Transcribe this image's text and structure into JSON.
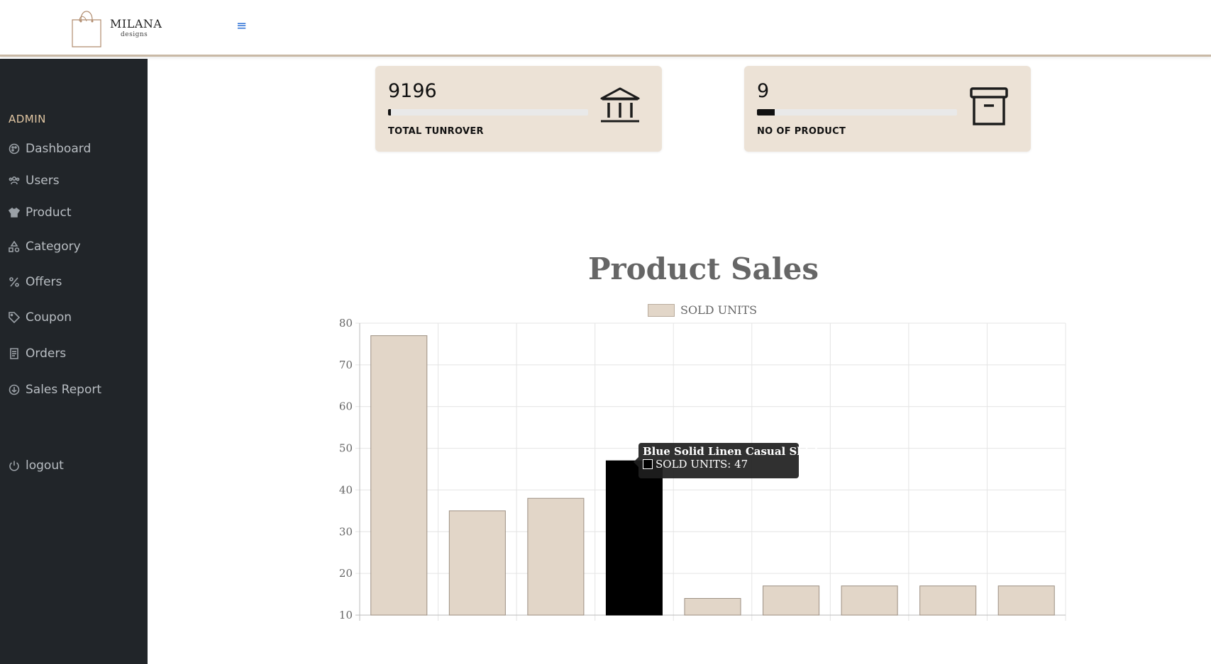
{
  "header": {
    "logo_name": "MILANA",
    "logo_sub": "designs",
    "menu_icon": "hamburger-icon"
  },
  "sidebar": {
    "heading": "ADMIN",
    "items": [
      {
        "label": "Dashboard",
        "icon": "palette-icon"
      },
      {
        "label": "Users",
        "icon": "users-icon"
      },
      {
        "label": "Product",
        "icon": "shirt-icon"
      },
      {
        "label": "Category",
        "icon": "shapes-icon"
      },
      {
        "label": "Offers",
        "icon": "percent-icon"
      },
      {
        "label": "Coupon",
        "icon": "tag-icon"
      },
      {
        "label": "Orders",
        "icon": "receipt-icon"
      },
      {
        "label": "Sales Report",
        "icon": "download-circle-icon"
      },
      {
        "label": "logout",
        "icon": "power-icon"
      }
    ]
  },
  "cards": {
    "turnover": {
      "value": "9196",
      "label": "TOTAL TUNROVER",
      "progress": 0.015,
      "icon": "bank-icon"
    },
    "products": {
      "value": "9",
      "label": "NO OF PRODUCT",
      "progress": 0.09,
      "icon": "archive-icon"
    }
  },
  "chart_data": {
    "type": "bar",
    "title": "Product Sales",
    "series": [
      {
        "name": "SOLD UNITS",
        "values": [
          77,
          35,
          38,
          47,
          14,
          17,
          17,
          17,
          17
        ]
      }
    ],
    "ylim": [
      10,
      80
    ],
    "yticks": [
      10,
      20,
      30,
      40,
      50,
      60,
      70,
      80
    ],
    "bar_color": "#e2d6c8",
    "bar_border": "#9c8f82",
    "highlight_color": "#000000",
    "highlight_index": 3,
    "grid": true,
    "legend": "top"
  },
  "tooltip": {
    "title": "Blue Solid Linen Casual Shirt",
    "body": "SOLD UNITS: 47"
  }
}
